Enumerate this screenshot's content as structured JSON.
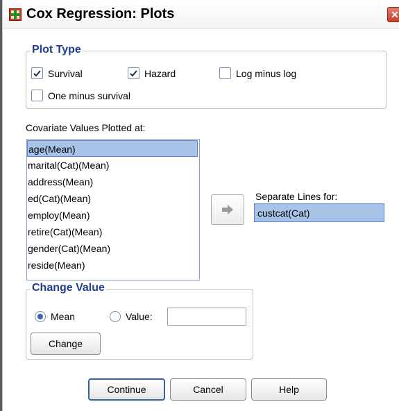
{
  "window": {
    "title": "Cox Regression: Plots",
    "close_glyph": "✕"
  },
  "plot_type": {
    "title": "Plot Type",
    "survival": {
      "label": "Survival",
      "checked": true
    },
    "hazard": {
      "label": "Hazard",
      "checked": true
    },
    "log_minus_log": {
      "label": "Log minus log",
      "checked": false
    },
    "one_minus_survival": {
      "label": "One minus survival",
      "checked": false
    }
  },
  "covariates": {
    "label": "Covariate Values Plotted at:",
    "items": [
      "age(Mean)",
      "marital(Cat)(Mean)",
      "address(Mean)",
      "ed(Cat)(Mean)",
      "employ(Mean)",
      "retire(Cat)(Mean)",
      "gender(Cat)(Mean)",
      "reside(Mean)"
    ],
    "selected_index": 0
  },
  "separate_lines": {
    "label": "Separate Lines for:",
    "value": "custcat(Cat)"
  },
  "change_value": {
    "title": "Change Value",
    "mean_label": "Mean",
    "value_label": "Value:",
    "selected": "mean",
    "value_text": "",
    "change_button": "Change"
  },
  "buttons": {
    "continue": "Continue",
    "cancel": "Cancel",
    "help": "Help"
  },
  "icons": {
    "title_icon": "plus-grid-icon",
    "arrow_icon": "right-arrow-icon"
  }
}
